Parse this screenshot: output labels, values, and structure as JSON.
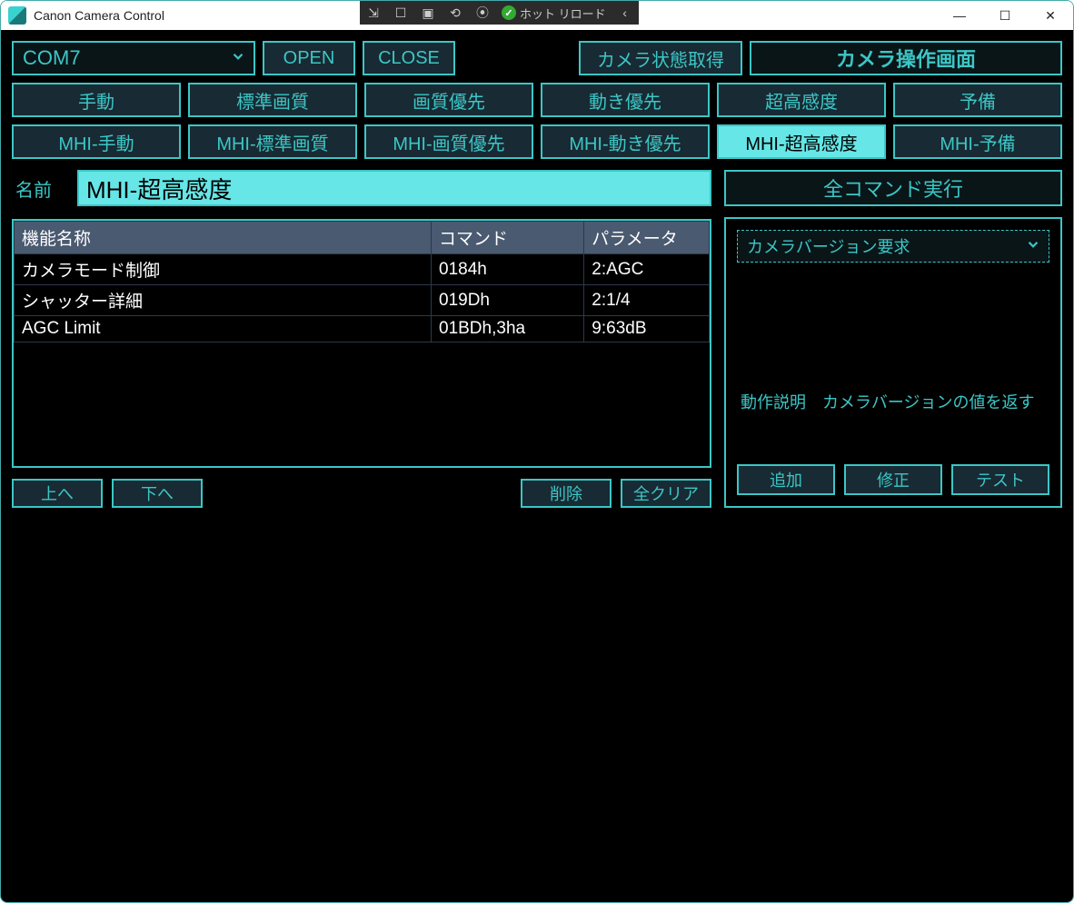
{
  "window": {
    "title": "Canon Camera Control",
    "vs_hot_reload": "ホット リロード"
  },
  "toolbar": {
    "port": "COM7",
    "open": "OPEN",
    "close": "CLOSE",
    "get_status": "カメラ状態取得",
    "camera_screen": "カメラ操作画面"
  },
  "presets_row1": [
    "手動",
    "標準画質",
    "画質優先",
    "動き優先",
    "超高感度",
    "予備"
  ],
  "presets_row2": [
    "MHI-手動",
    "MHI-標準画質",
    "MHI-画質優先",
    "MHI-動き優先",
    "MHI-超高感度",
    "MHI-予備"
  ],
  "active_preset": "MHI-超高感度",
  "name_section": {
    "label": "名前",
    "value": "MHI-超高感度"
  },
  "table": {
    "headers": {
      "name": "機能名称",
      "cmd": "コマンド",
      "param": "パラメータ"
    },
    "rows": [
      {
        "name": "カメラモード制御",
        "cmd": "0184h",
        "param": "2:AGC"
      },
      {
        "name": "シャッター詳細",
        "cmd": "019Dh",
        "param": "2:1/4"
      },
      {
        "name": "AGC Limit",
        "cmd": "01BDh,3ha",
        "param": "9:63dB"
      }
    ]
  },
  "left_buttons": {
    "up": "上へ",
    "down": "下へ",
    "delete": "削除",
    "clear": "全クリア"
  },
  "right_panel": {
    "run_all": "全コマンド実行",
    "cmd_select": "カメラバージョン要求",
    "desc_label": "動作説明",
    "desc_text": "カメラバージョンの値を返す",
    "add": "追加",
    "edit": "修正",
    "test": "テスト"
  }
}
